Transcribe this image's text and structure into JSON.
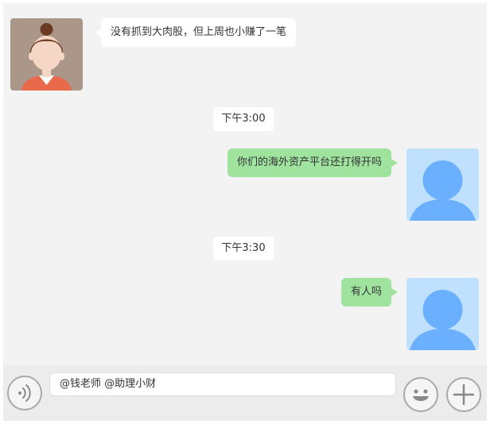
{
  "messages": [
    {
      "side": "left",
      "sender": "woman-avatar",
      "text": "没有抓到大肉股，但上周也小赚了一笔"
    },
    {
      "type": "time",
      "text": "下午3:00"
    },
    {
      "side": "right",
      "sender": "default-avatar",
      "text": "你们的海外资产平台还打得开吗"
    },
    {
      "type": "time",
      "text": "下午3:30"
    },
    {
      "side": "right",
      "sender": "default-avatar",
      "text": "有人吗"
    }
  ],
  "input": {
    "value": "@钱老师 @助理小财"
  },
  "icons": {
    "voice": "voice-icon",
    "emoji": "emoji-icon",
    "plus": "plus-icon"
  },
  "colors": {
    "chat_background": "#f3f3f3",
    "sent_bubble": "#9fe39f",
    "received_bubble": "#ffffff",
    "default_avatar_bg": "#bfe0ff",
    "default_avatar_fg": "#6ab0ff"
  }
}
